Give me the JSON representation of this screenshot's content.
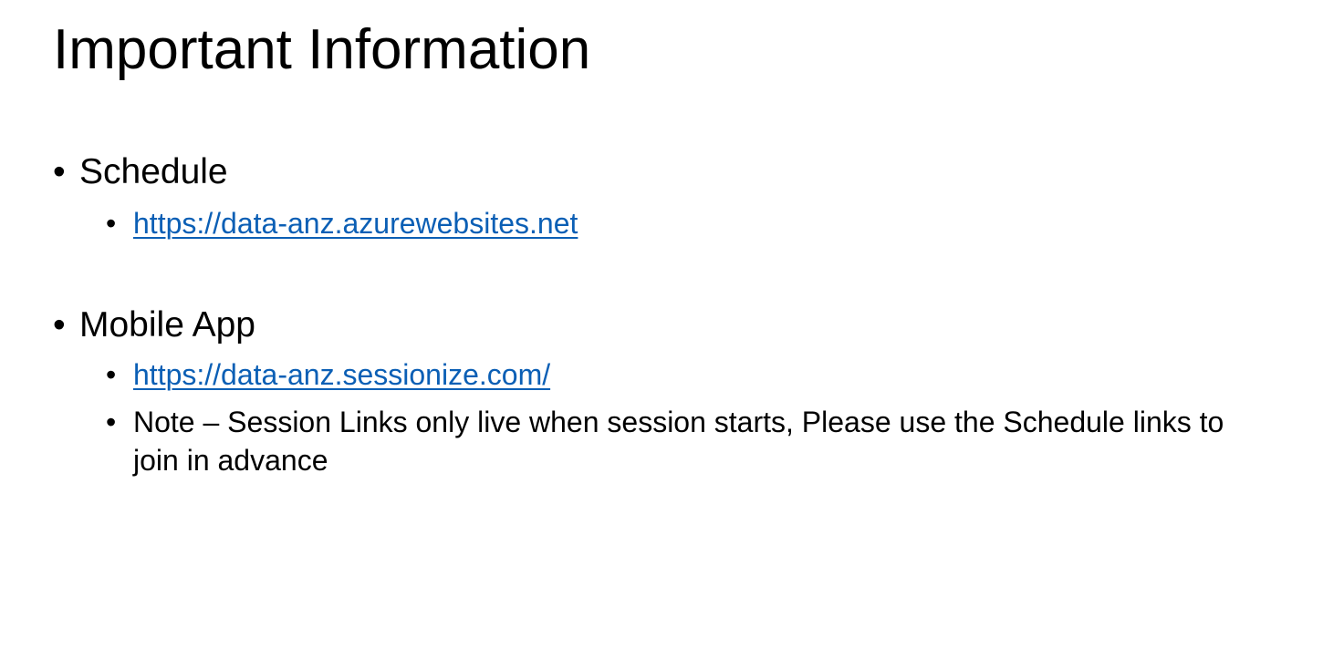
{
  "slide": {
    "title": "Important Information",
    "sections": [
      {
        "label": "Schedule",
        "links": [
          "https://data-anz.azurewebsites.net"
        ]
      },
      {
        "label": "Mobile App",
        "links": [
          "https://data-anz.sessionize.com/"
        ],
        "note": "Note – Session Links only live when session starts, Please use the Schedule links to join in advance"
      }
    ],
    "bullet_glyph": "•",
    "colors": {
      "link": "#0b5fb5",
      "text": "#000000",
      "background": "#ffffff"
    }
  }
}
